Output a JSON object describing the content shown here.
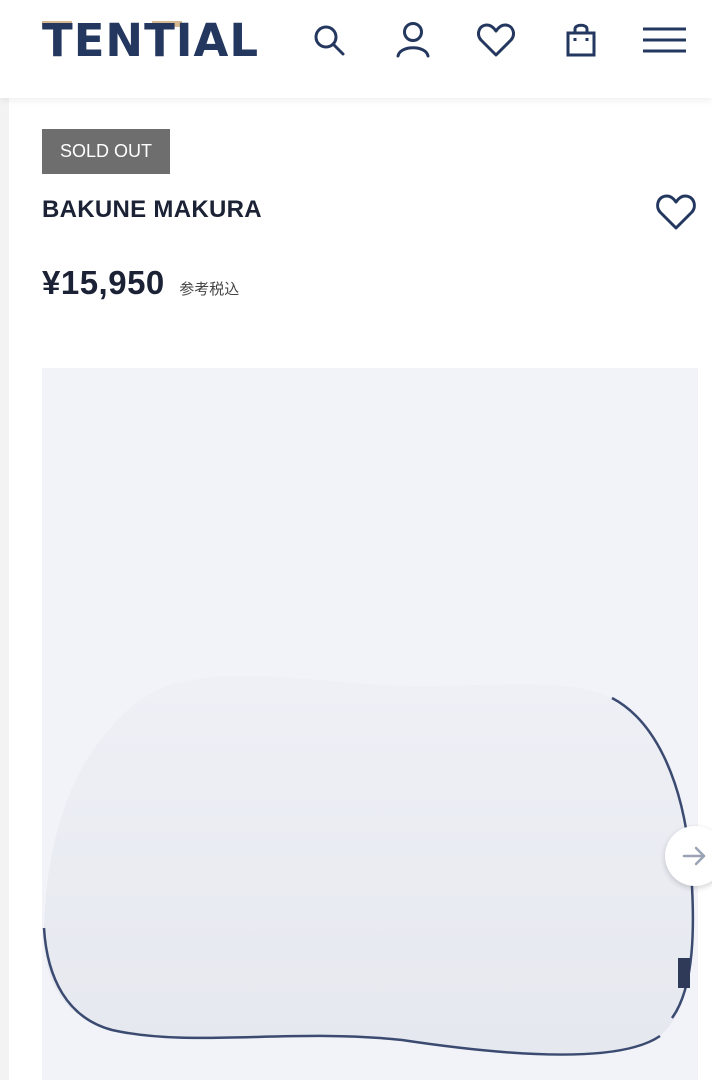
{
  "header": {
    "brand": "TENTIAL",
    "icons": [
      "search-icon",
      "account-icon",
      "heart-icon",
      "bag-icon",
      "menu-icon"
    ],
    "brand_color": "#23375f",
    "accent_color": "#d6b990"
  },
  "product": {
    "badge": "SOLD OUT",
    "name": "BAKUNE MAKURA",
    "price": "¥15,950",
    "tax_note": "参考税込"
  },
  "gallery": {
    "next_icon": "arrow-right-icon"
  }
}
